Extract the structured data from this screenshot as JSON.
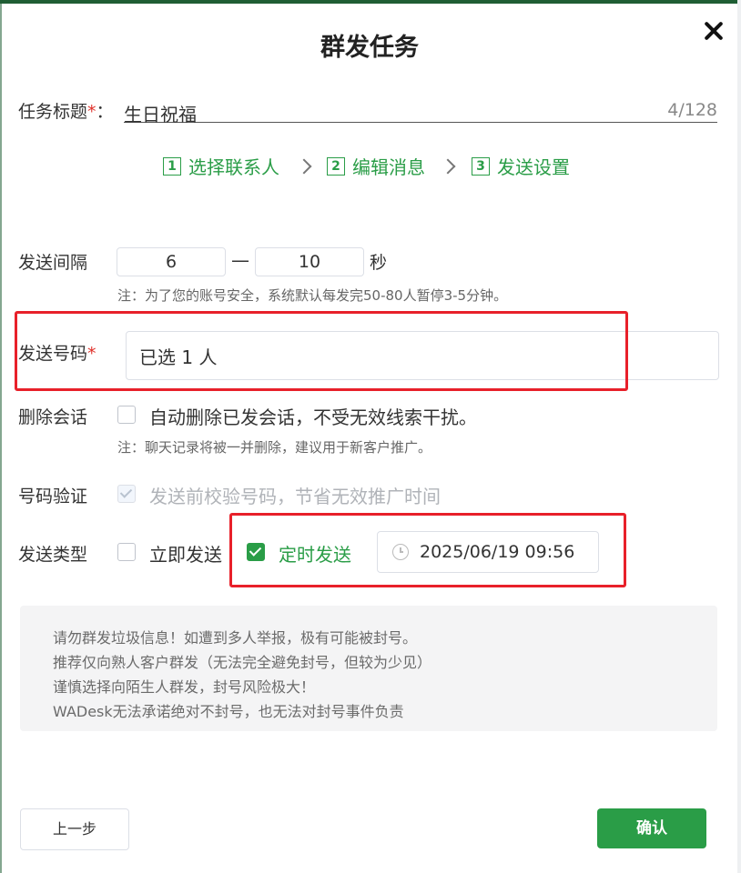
{
  "dialog": {
    "title": "群发任务",
    "close_icon": "close-icon"
  },
  "task_title": {
    "label": "任务标题",
    "required_mark": "*",
    "colon": "：",
    "value": "生日祝福",
    "counter": "4/128"
  },
  "steps": [
    {
      "num": "1",
      "label": "选择联系人"
    },
    {
      "num": "2",
      "label": "编辑消息"
    },
    {
      "num": "3",
      "label": "发送设置"
    }
  ],
  "interval": {
    "label": "发送间隔",
    "min": "6",
    "separator": "—",
    "max": "10",
    "unit": "秒",
    "note": "注：为了您的账号安全，系统默认每发完50-80人暂停3-5分钟。"
  },
  "phones": {
    "label": "发送号码",
    "required_mark": "*",
    "value": "已选 1 人"
  },
  "delete_chat": {
    "label": "删除会话",
    "option": "自动删除已发会话，不受无效线索干扰。",
    "checked": false,
    "note": "注：聊天记录将被一并删除，建议用于新客户推广。"
  },
  "verify": {
    "label": "号码验证",
    "option": "发送前校验号码，节省无效推广时间",
    "checked": true,
    "disabled": true
  },
  "send_type": {
    "label": "发送类型",
    "immediate": "立即发送",
    "immediate_checked": false,
    "scheduled": "定时发送",
    "scheduled_checked": true,
    "datetime": "2025/06/19 09:56"
  },
  "warning": [
    "请勿群发垃圾信息！如遭到多人举报，极有可能被封号。",
    "推荐仅向熟人客户群发（无法完全避免封号，但较为少见）",
    "谨慎选择向陌生人群发，封号风险极大！",
    "WADesk无法承诺绝对不封号，也无法对封号事件负责"
  ],
  "buttons": {
    "prev": "上一步",
    "confirm": "确认"
  },
  "colors": {
    "accent": "#2a9d47",
    "highlight": "#e8202a"
  }
}
